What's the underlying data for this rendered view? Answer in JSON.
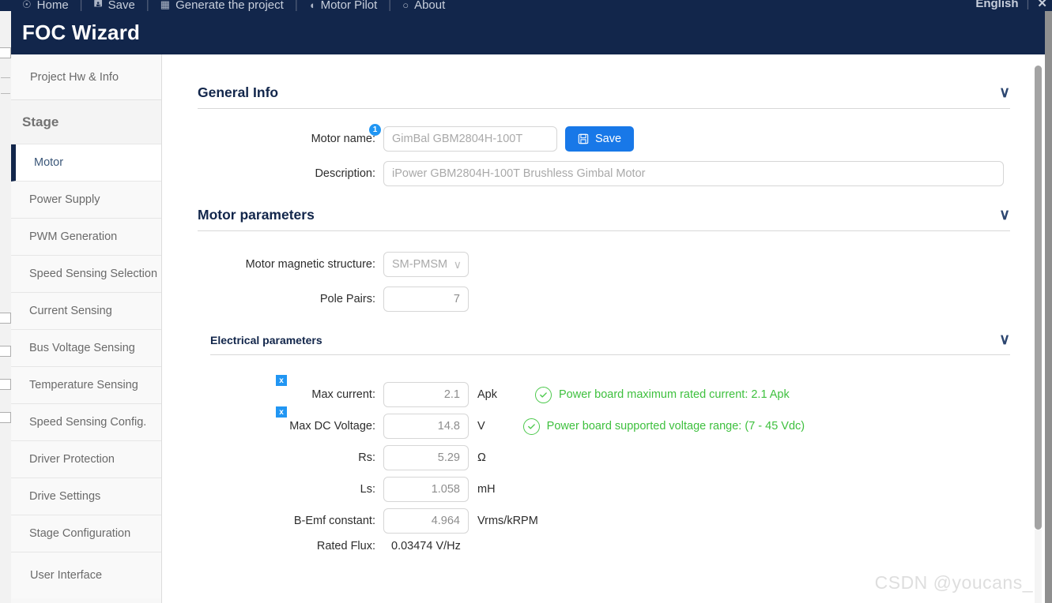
{
  "outer_menu": {
    "items": [
      {
        "label": "Home",
        "icon": "home-icon"
      },
      {
        "label": "Save",
        "icon": "save-icon"
      },
      {
        "label": "Generate the project",
        "icon": "generate-icon"
      },
      {
        "label": "Motor Pilot",
        "icon": "motor-pilot-icon"
      },
      {
        "label": "About",
        "icon": "about-icon"
      }
    ],
    "language": "English",
    "close_glyph": "✕",
    "separator": "|"
  },
  "header": {
    "title": "FOC Wizard"
  },
  "sidebar": {
    "top_link": "Project Hw & Info",
    "group_label": "Stage",
    "items": [
      {
        "label": "Motor",
        "active": true
      },
      {
        "label": "Power Supply",
        "active": false
      },
      {
        "label": "PWM Generation",
        "active": false
      },
      {
        "label": "Speed Sensing Selection",
        "active": false
      },
      {
        "label": "Current Sensing",
        "active": false
      },
      {
        "label": "Bus Voltage Sensing",
        "active": false
      },
      {
        "label": "Temperature Sensing",
        "active": false
      },
      {
        "label": "Speed Sensing Config.",
        "active": false
      },
      {
        "label": "Driver Protection",
        "active": false
      },
      {
        "label": "Drive Settings",
        "active": false
      },
      {
        "label": "Stage Configuration",
        "active": false
      }
    ],
    "bottom_link": "User Interface"
  },
  "general_info": {
    "title": "General Info",
    "chevron": "∨",
    "motor_name_label": "Motor name:",
    "motor_name_value": "GimBal GBM2804H-100T",
    "motor_name_badge": "1",
    "save_label": "Save",
    "description_label": "Description:",
    "description_value": "iPower GBM2804H-100T Brushless Gimbal Motor"
  },
  "motor_parameters": {
    "title": "Motor parameters",
    "chevron": "∨",
    "magnetic_structure_label": "Motor magnetic structure:",
    "magnetic_structure_value": "SM-PMSM",
    "select_chevron": "∨",
    "pole_pairs_label": "Pole Pairs:",
    "pole_pairs_value": "7"
  },
  "electrical_parameters": {
    "title": "Electrical parameters",
    "chevron": "∨",
    "clear_badge": "x",
    "rows": [
      {
        "label": "Max current:",
        "value": "2.1",
        "unit": "Apk",
        "hint": "Power board maximum rated current: 2.1 Apk",
        "has_badge": true
      },
      {
        "label": "Max DC Voltage:",
        "value": "14.8",
        "unit": "V",
        "hint": "Power board supported voltage range: (7 - 45 Vdc)",
        "has_badge": true
      },
      {
        "label": "Rs:",
        "value": "5.29",
        "unit": "Ω",
        "hint": "",
        "has_badge": false
      },
      {
        "label": "Ls:",
        "value": "1.058",
        "unit": "mH",
        "hint": "",
        "has_badge": false
      },
      {
        "label": "B-Emf constant:",
        "value": "4.964",
        "unit": "Vrms/kRPM",
        "hint": "",
        "has_badge": false
      }
    ],
    "rated_flux_label": "Rated Flux:",
    "rated_flux_value": "0.03474 V/Hz"
  },
  "watermark": "CSDN @youcans_",
  "colors": {
    "header_navy": "#12264b",
    "accent_blue": "#1878e8",
    "badge_blue": "#2196f3",
    "success_green": "#3ec03e",
    "sidebar_bg": "#f7f7f7"
  }
}
